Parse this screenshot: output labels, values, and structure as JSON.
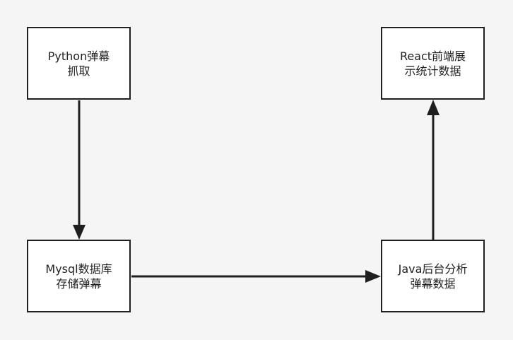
{
  "diagram": {
    "nodes": {
      "python": {
        "line1": "Python弹幕",
        "line2": "抓取"
      },
      "react": {
        "line1": "React前端展",
        "line2": "示统计数据"
      },
      "mysql": {
        "line1": "Mysql数据库",
        "line2": "存储弹幕"
      },
      "java": {
        "line1": "Java后台分析",
        "line2": "弹幕数据"
      }
    },
    "edges": [
      {
        "from": "python",
        "to": "mysql"
      },
      {
        "from": "mysql",
        "to": "java"
      },
      {
        "from": "java",
        "to": "react"
      }
    ]
  },
  "colors": {
    "background": "#f5f5f5",
    "node_fill": "#ffffff",
    "stroke": "#1f1f1f",
    "text": "#222222"
  }
}
